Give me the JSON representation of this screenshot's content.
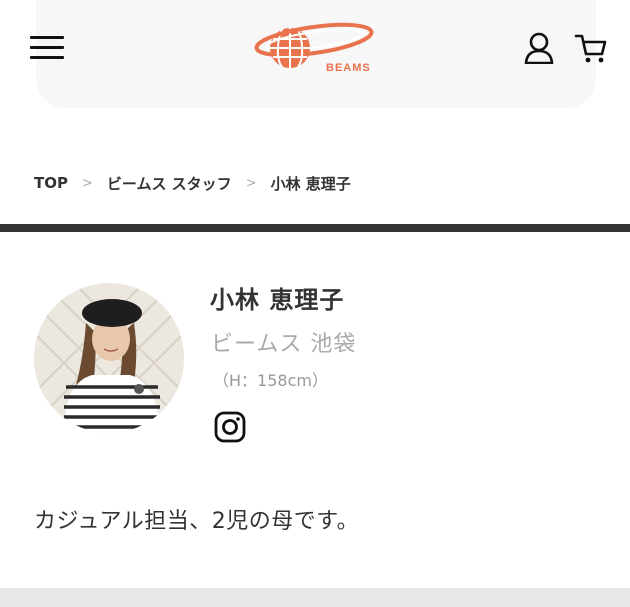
{
  "header": {
    "menu_icon": "hamburger-menu-icon",
    "logo_text": "BEAMS",
    "user_icon": "user-icon",
    "cart_icon": "cart-icon"
  },
  "breadcrumb": {
    "items": [
      "TOP",
      "ビームス スタッフ",
      "小林 恵理子"
    ],
    "separator": ">"
  },
  "profile": {
    "name": "小林 恵理子",
    "store": "ビームス 池袋",
    "height": "（H：158cm）",
    "social_icon": "instagram-icon",
    "bio": "カジュアル担当、2児の母です。"
  },
  "colors": {
    "brand": "#e8734d",
    "divider": "#333333",
    "muted": "#aaaaaa"
  }
}
